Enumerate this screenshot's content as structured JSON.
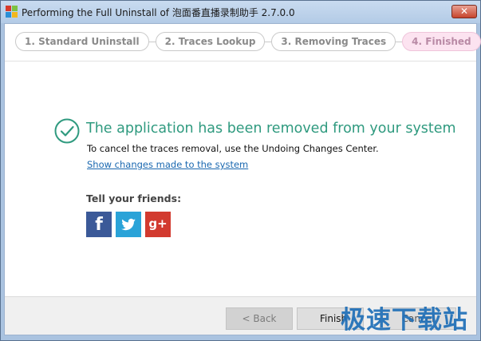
{
  "window": {
    "title": "Performing the Full Uninstall of 泡面番直播录制助手 2.7.0.0",
    "close_glyph": "✕"
  },
  "steps": [
    {
      "label": "1. Standard Uninstall",
      "active": false
    },
    {
      "label": "2. Traces Lookup",
      "active": false
    },
    {
      "label": "3. Removing Traces",
      "active": false
    },
    {
      "label": "4. Finished",
      "active": true
    }
  ],
  "result": {
    "icon": "check-circle-icon",
    "headline": "The application has been removed from your system",
    "subtext": "To cancel the traces removal, use the Undoing Changes Center.",
    "link": "Show changes made to the system"
  },
  "social": {
    "label": "Tell your friends:",
    "facebook_glyph": "f",
    "gplus_glyph": "g+"
  },
  "footer": {
    "back_label": "< Back",
    "finish_label": "Finish",
    "cancel_label": "Cancel"
  },
  "watermark": "极速下载站",
  "colors": {
    "accent_green": "#2f9a7f",
    "active_step_bg": "#fce3f0",
    "link": "#1a68b0",
    "facebook": "#3b5998",
    "twitter": "#2aa3d8",
    "gplus": "#d23a2f"
  }
}
